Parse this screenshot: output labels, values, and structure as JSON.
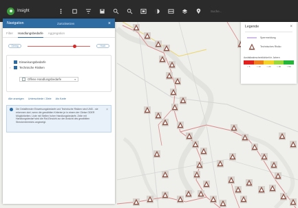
{
  "app": {
    "name": "Insight"
  },
  "toolbar": {
    "icons": [
      "grid-icon",
      "crosshair-icon",
      "filter-icon",
      "save-icon",
      "zoom-in-icon",
      "zoom-out-icon",
      "image-icon",
      "contrast-icon",
      "table-icon",
      "layers-icon",
      "location-icon"
    ],
    "search_placeholder": "Suche..."
  },
  "navigation": {
    "title": "Navigation",
    "action": "Zurücksetzen",
    "tabs": [
      {
        "label": "Filter",
        "active": false
      },
      {
        "label": "Handlungsbedarfe",
        "active": true
      },
      {
        "label": "Aggregation",
        "active": false
      }
    ],
    "slider": {
      "min_label": "Gering",
      "max_label": "Hoch",
      "value": 0.72
    },
    "filters": [
      {
        "label": "Einweisungsbedarfe",
        "checked": true,
        "expandable": false
      },
      {
        "label": "Technische Risiken",
        "checked": true,
        "expandable": true
      }
    ],
    "dropdown": {
      "label": "Offene Handlungsbedarfe",
      "checked": false
    },
    "links": [
      "Alle anzeigen",
      "Unterschiede / Ziele",
      "Als Karte"
    ],
    "info": "Die Detailfenster Einweisungsbedarfe und Technische Risiken sind UND - sie erkennen dort, wenn die gewählten Kriterien je in einem der Gleise ODER Möglichkeiten. Liste mit Stellen hoher Handlungsbedarfe, Zeile mit Handlungsbedarf wird die Rot-Einsicht zur der Ansicht des gewählten Streckenbereichs angezeigt."
  },
  "legend": {
    "title": "Legende",
    "items": [
      {
        "symbol": "line-icon",
        "label": "Sperrmeldung"
      },
      {
        "symbol": "warning-triangle-icon",
        "label": "Technisches Risiko"
      }
    ],
    "scale_title": "Ausfallwahrscheinlichkeit in Jahren",
    "scale_colors": [
      "#e12020",
      "#f07f1e",
      "#f4d42a",
      "#9bd83b",
      "#26b43a"
    ],
    "scale_labels": [
      "< 5",
      "> 10",
      "> 20",
      "> 30",
      "> 50"
    ]
  },
  "map": {
    "markers": [
      {
        "label": ""
      }
    ]
  }
}
